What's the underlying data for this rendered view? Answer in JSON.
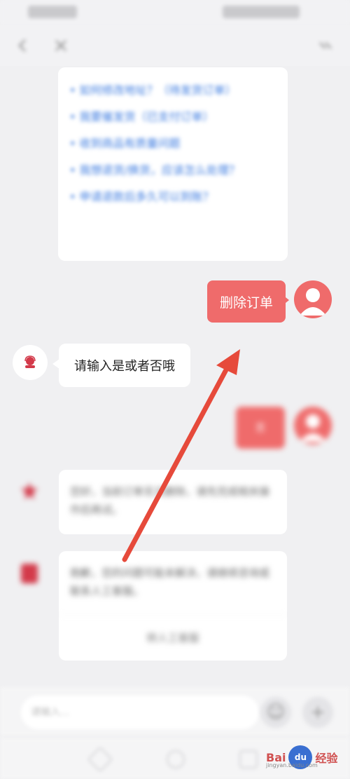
{
  "status_bar": {},
  "faq": {
    "items": [
      "• 如何修改地址？（待发货订单）",
      "• 我要催发货（已支付订单）",
      "• 收到商品有质量问题",
      "• 我想退货/换货，应该怎么处理？",
      "• 申请退款后多久可以到账？"
    ]
  },
  "chat": {
    "user_message": "删除订单",
    "bot_message": "请输入是或者否哦",
    "user_message_2": "否",
    "bot_card_a": "您好，当前订单无法删除，请先完成相关操作后再试。",
    "bot_card_b": "抱歉，您的问题可能未解决，请继续咨询或联系人工客服。",
    "bot_card_b_button": "转人工客服"
  },
  "input": {
    "placeholder": "请输入..."
  },
  "watermark": {
    "brand": "Bai",
    "brand_cn": "经验",
    "url": "jingyan.baidu.com"
  },
  "colors": {
    "accent": "#ef6b6b",
    "arrow": "#e64a3b",
    "link": "#3c7be0"
  }
}
